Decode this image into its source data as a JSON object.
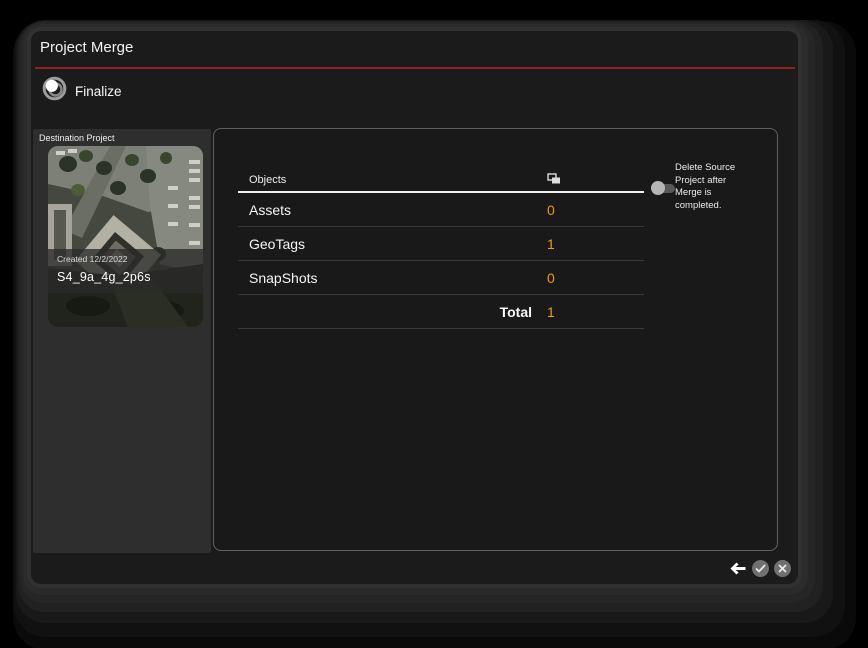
{
  "window": {
    "title": "Project Merge"
  },
  "colors": {
    "divider_red": "#8b2121",
    "value_orange": "#ef9b0d",
    "panel_gray": "#2e2e2e"
  },
  "finalize": {
    "label": "Finalize",
    "icon": "merge-circles-icon"
  },
  "destination": {
    "section_label": "Destination Project",
    "created": "Created 12/2/2022",
    "name": "S4_9a_4g_2p6s"
  },
  "table": {
    "header": "Objects",
    "header_icon": "overlapping-frames-icon",
    "rows": [
      {
        "label": "Assets",
        "value": "0"
      },
      {
        "label": "GeoTags",
        "value": "1"
      },
      {
        "label": "SnapShots",
        "value": "0"
      }
    ],
    "total_label": "Total",
    "total_value": "1"
  },
  "delete_toggle": {
    "state": "off",
    "label": "Delete Source Project after Merge is completed."
  },
  "actions": {
    "back_icon": "back-arrow-icon",
    "confirm_icon": "check-circle-icon",
    "cancel_icon": "close-circle-icon"
  }
}
